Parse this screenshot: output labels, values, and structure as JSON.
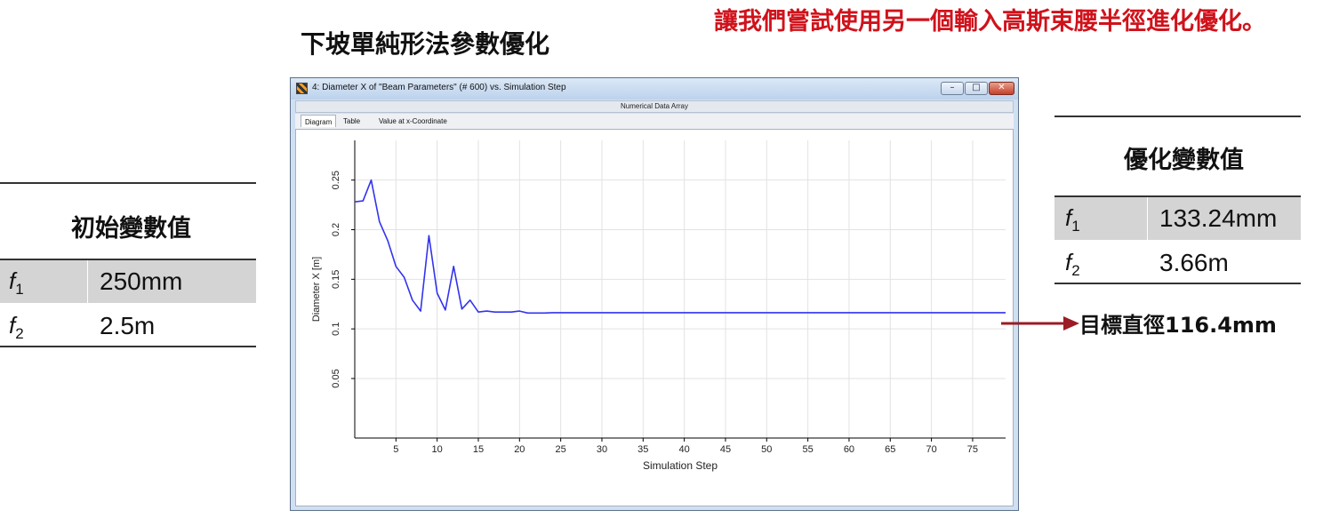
{
  "slide": {
    "title": "下坡單純形法參數優化",
    "note": "讓我們嘗試使用另一個輸入高斯束腰半徑進化優化。",
    "target_label": "目標直徑116.4mm"
  },
  "initial_table": {
    "header": "初始變數值",
    "rows": [
      {
        "symbol": "f",
        "sub": "1",
        "value": "250mm"
      },
      {
        "symbol": "f",
        "sub": "2",
        "value": "2.5m"
      }
    ]
  },
  "optimized_table": {
    "header": "優化變數值",
    "rows": [
      {
        "symbol": "f",
        "sub": "1",
        "value": "133.24mm"
      },
      {
        "symbol": "f",
        "sub": "2",
        "value": "3.66m"
      }
    ]
  },
  "window": {
    "title": "4: Diameter X of \"Beam Parameters\" (# 600) vs. Simulation Step",
    "subheader": "Numerical Data Array",
    "tabs": [
      "Diagram",
      "Table",
      "Value at x-Coordinate"
    ],
    "buttons": {
      "minimize": "–",
      "maximize": "□",
      "close": "✕"
    }
  },
  "colors": {
    "note": "#d0121b",
    "line": "#3333ee",
    "arrow": "#9b1c24"
  },
  "chart_data": {
    "type": "line",
    "xlabel": "Simulation Step",
    "ylabel": "Diameter X [m]",
    "xlim": [
      0,
      79
    ],
    "ylim": [
      -0.01,
      0.29
    ],
    "xticks": [
      5,
      10,
      15,
      20,
      25,
      30,
      35,
      40,
      45,
      50,
      55,
      60,
      65,
      70,
      75
    ],
    "yticks": [
      0.05,
      0.1,
      0.15,
      0.2,
      0.25
    ],
    "ytick_labels": [
      "0.05",
      "0.1",
      "0.15",
      "0.2",
      "0.25"
    ],
    "grid": true,
    "x": [
      0,
      1,
      2,
      3,
      4,
      5,
      6,
      7,
      8,
      9,
      10,
      11,
      12,
      13,
      14,
      15,
      16,
      17,
      18,
      19,
      20,
      21,
      22,
      23,
      24,
      25,
      30,
      40,
      50,
      60,
      70,
      79
    ],
    "y": [
      0.228,
      0.229,
      0.25,
      0.208,
      0.189,
      0.163,
      0.152,
      0.129,
      0.118,
      0.194,
      0.136,
      0.119,
      0.163,
      0.12,
      0.129,
      0.117,
      0.118,
      0.117,
      0.117,
      0.117,
      0.118,
      0.116,
      0.116,
      0.116,
      0.1164,
      0.1164,
      0.1164,
      0.1164,
      0.1164,
      0.1164,
      0.1164,
      0.1164
    ]
  }
}
